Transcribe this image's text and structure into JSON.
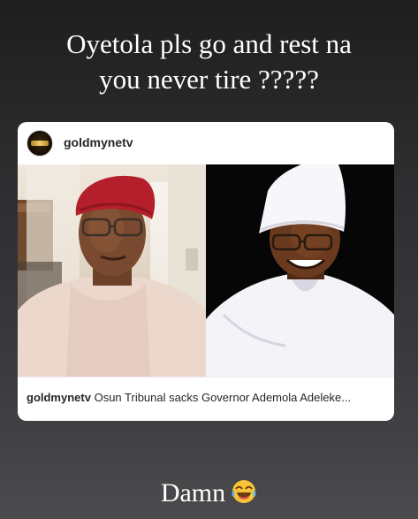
{
  "story": {
    "caption_line1": "Oyetola pls go and rest na",
    "caption_line2": "you never tire ?????",
    "reply_text": "Damn"
  },
  "post": {
    "username": "goldmynetv",
    "caption_user": "goldmynetv",
    "caption_text": " Osun Tribunal sacks Governor Ademola Adeleke...",
    "left_photo": "man-in-red-cap-and-cream-agbada",
    "right_photo": "man-in-white-cap-and-white-agbada"
  },
  "icons": {
    "reply_emoji": "face-with-tears-of-joy-icon"
  }
}
